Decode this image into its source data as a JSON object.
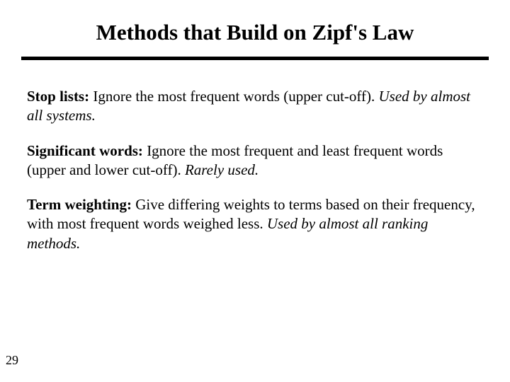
{
  "title": "Methods that Build on Zipf's Law",
  "items": [
    {
      "label": "Stop lists:",
      "description": "  Ignore the most frequent words (upper cut-off).  ",
      "usage": "Used by almost all systems."
    },
    {
      "label": "Significant words:",
      "description": "  Ignore the most frequent and least frequent words (upper and lower cut-off).  ",
      "usage": "Rarely used."
    },
    {
      "label": "Term weighting:",
      "description": "  Give differing weights to terms based on their frequency, with most frequent words weighed less.  ",
      "usage": "Used by almost all ranking methods."
    }
  ],
  "page_number": "29"
}
